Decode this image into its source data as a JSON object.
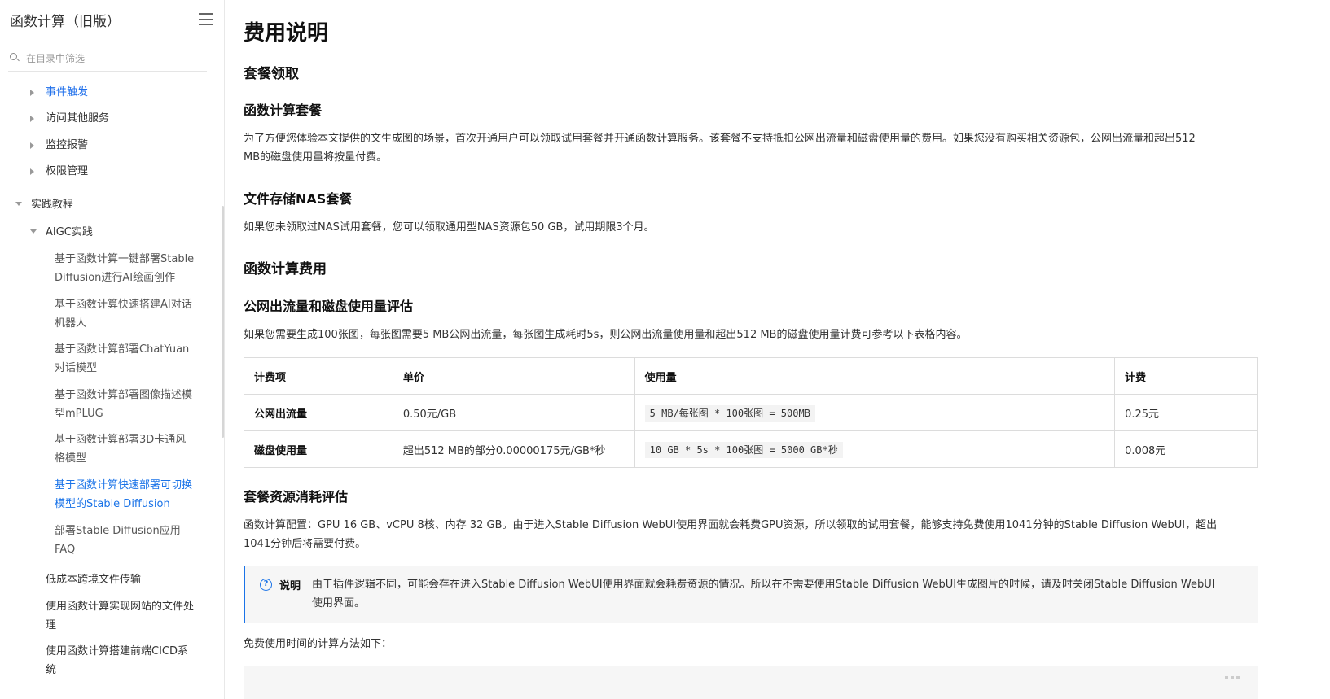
{
  "sidebar": {
    "title": "函数计算（旧版）",
    "search_placeholder": "在目录中筛选",
    "items": [
      {
        "label": "事件触发"
      },
      {
        "label": "访问其他服务"
      },
      {
        "label": "监控报警"
      },
      {
        "label": "权限管理"
      },
      {
        "label": "实践教程"
      },
      {
        "label": "AIGC实践"
      },
      {
        "label_lines": [
          "基于函数计算一键部署Stable",
          "Diffusion进行AI绘画创作"
        ]
      },
      {
        "label_lines": [
          "基于函数计算快速搭建AI对话",
          "机器人"
        ]
      },
      {
        "label_lines": [
          "基于函数计算部署ChatYuan",
          "对话模型"
        ]
      },
      {
        "label_lines": [
          "基于函数计算部署图像描述模",
          "型mPLUG"
        ]
      },
      {
        "label_lines": [
          "基于函数计算部署3D卡通风",
          "格模型"
        ]
      },
      {
        "label_lines": [
          "基于函数计算快速部署可切换",
          "模型的Stable Diffusion"
        ]
      },
      {
        "label_lines": [
          "部署Stable Diffusion应用",
          "FAQ"
        ]
      },
      {
        "label": "低成本跨境文件传输"
      },
      {
        "label_lines": [
          "使用函数计算实现网站的文件处",
          "理"
        ]
      },
      {
        "label_lines": [
          "使用函数计算搭建前端CICD系",
          "统"
        ]
      }
    ]
  },
  "main": {
    "title": "费用说明",
    "section1": "套餐领取",
    "sub1": "函数计算套餐",
    "para1_lines": [
      "为了方便您体验本文提供的文生成图的场景，首次开通用户可以领取试用套餐并开通函数计算服务。该套餐不支持抵扣公网出流量和磁盘使用量的费用。如果您没有购买相关资源包，公网出流量和超出512",
      "MB的磁盘使用量将按量付费。"
    ],
    "sub2": "文件存储NAS套餐",
    "para2": "如果您未领取过NAS试用套餐，您可以领取通用型NAS资源包50 GB，试用期限3个月。",
    "section2": "函数计算费用",
    "sub3": "公网出流量和磁盘使用量评估",
    "para3": "如果您需要生成100张图，每张图需要5 MB公网出流量，每张图生成耗时5s，则公网出流量使用量和超出512 MB的磁盘使用量计费可参考以下表格内容。",
    "table": {
      "headers": [
        "计费项",
        "单价",
        "使用量",
        "计费"
      ],
      "rows": [
        [
          "公网出流量",
          "0.50元/GB",
          "5 MB/每张图 * 100张图 = 500MB",
          "0.25元"
        ],
        [
          "磁盘使用量",
          "超出512 MB的部分0.00000175元/GB*秒",
          "10 GB * 5s * 100张图 = 5000 GB*秒",
          "0.008元"
        ]
      ]
    },
    "sub4": "套餐资源消耗评估",
    "para4_lines": [
      "函数计算配置：GPU 16 GB、vCPU 8核、内存 32 GB。由于进入Stable Diffusion WebUI使用界面就会耗费GPU资源，所以领取的试用套餐，能够支持免费使用1041分钟的Stable Diffusion WebUI，超出",
      "1041分钟后将需要付费。"
    ],
    "note": {
      "label": "说明",
      "lines": [
        "由于插件逻辑不同，可能会存在进入Stable Diffusion WebUI使用界面就会耗费资源的情况。所以在不需要使用Stable Diffusion WebUI生成图片的时候，请及时关闭Stable Diffusion WebUI",
        "使用界面。"
      ]
    },
    "para5": "免费使用时间的计算方法如下："
  }
}
